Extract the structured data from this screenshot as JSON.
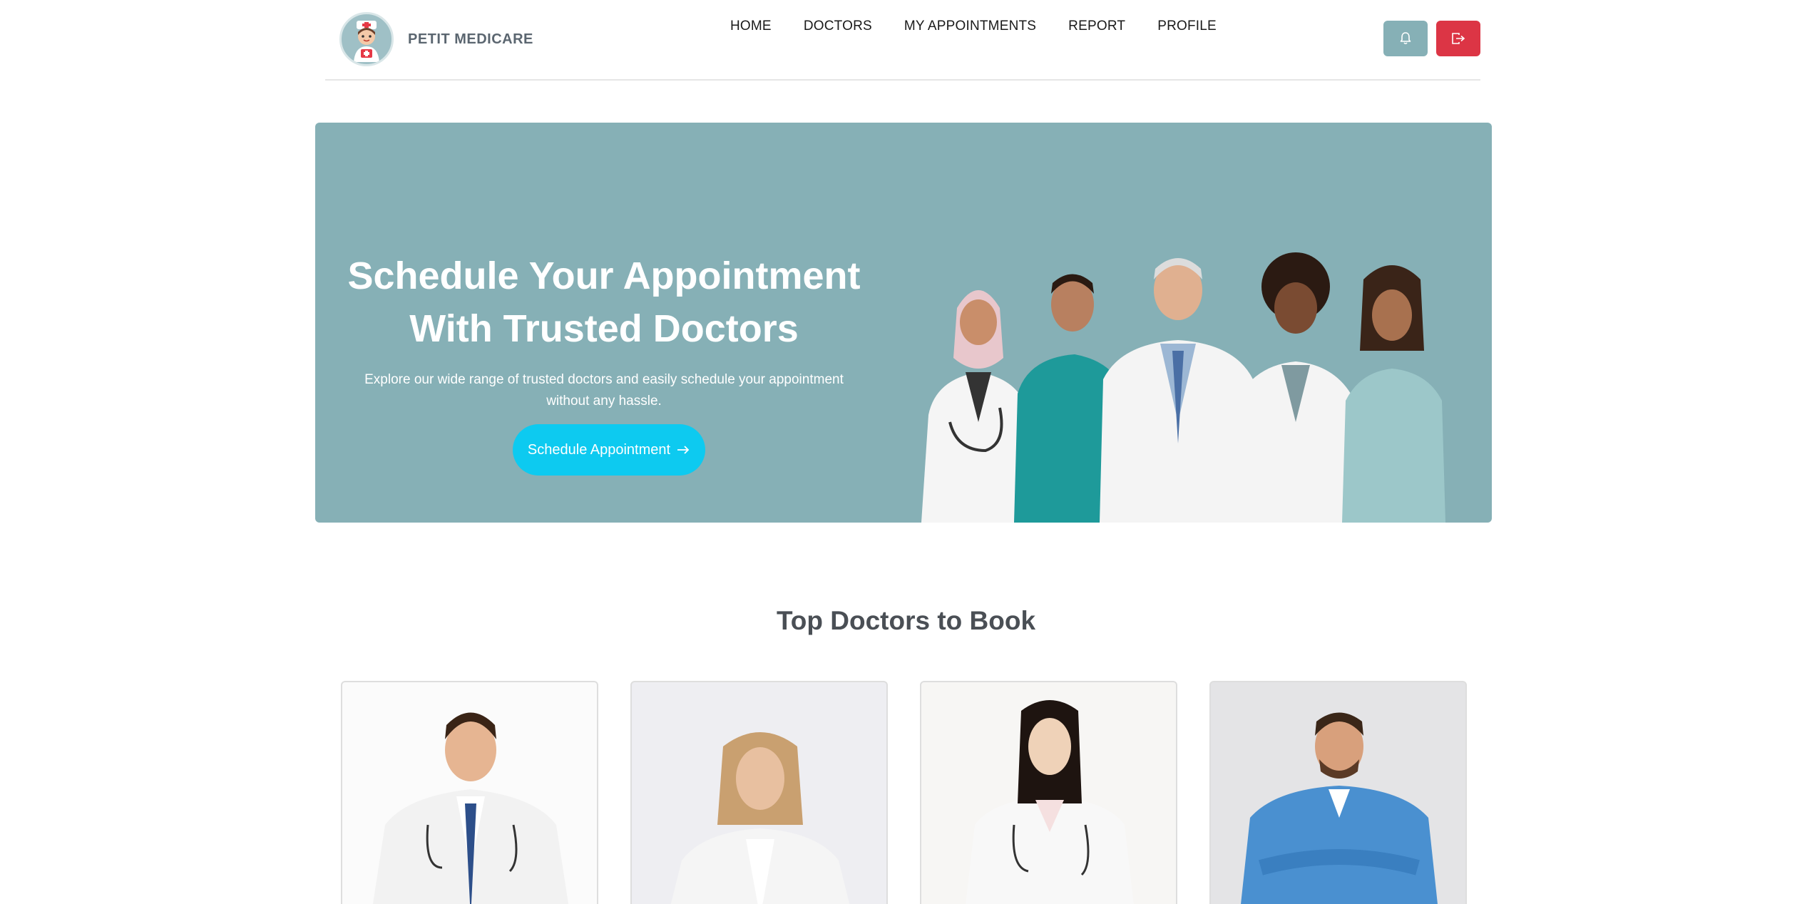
{
  "brand": {
    "name": "PETIT MEDICARE",
    "logo_icon": "nurse-mascot-icon"
  },
  "nav": {
    "items": [
      {
        "label": "HOME"
      },
      {
        "label": "DOCTORS"
      },
      {
        "label": "MY APPOINTMENTS"
      },
      {
        "label": "REPORT"
      },
      {
        "label": "PROFILE"
      }
    ],
    "actions": [
      {
        "icon": "bell-icon",
        "color": "#86b0b6"
      },
      {
        "icon": "logout-icon",
        "color": "#dc3545"
      }
    ]
  },
  "hero": {
    "title_line1": "Schedule Your Appointment",
    "title_line2": "With Trusted Doctors",
    "subtitle": "Explore our wide range of trusted doctors and easily schedule your appointment without any hassle.",
    "button_label": "Schedule Appointment",
    "button_icon": "arrow-right-icon",
    "background": "#86b0b6",
    "button_color": "#0dcaf0"
  },
  "top_doctors": {
    "title": "Top Doctors to Book",
    "cards": [
      {
        "photo": "doctor-photo"
      },
      {
        "photo": "doctor-photo"
      },
      {
        "photo": "doctor-photo"
      },
      {
        "photo": "doctor-photo"
      }
    ]
  }
}
